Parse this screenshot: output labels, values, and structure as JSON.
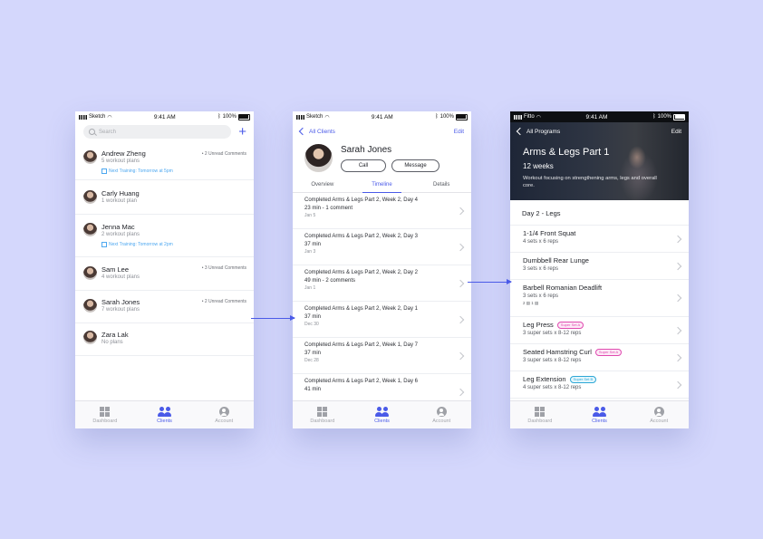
{
  "colors": {
    "accent": "#4a5ae8",
    "background": "#d4d7fc",
    "link_blue": "#4ea8f0",
    "superset_pink": "#e04ab0",
    "superset_blue": "#2da7d6"
  },
  "status_bar": {
    "carrier": "Sketch",
    "carrier3": "Fitto",
    "time": "9:41 AM",
    "battery": "100%"
  },
  "tabbar": {
    "dashboard": "Dashboard",
    "clients": "Clients",
    "account": "Account"
  },
  "screen1": {
    "search_placeholder": "Search",
    "clients": [
      {
        "name": "Andrew Zheng",
        "plans": "5 workout plans",
        "unread": "• 2 Unread Comments",
        "next": "Next Training: Tomorrow at 5pm"
      },
      {
        "name": "Carly Huang",
        "plans": "1 workout plan",
        "unread": "",
        "next": ""
      },
      {
        "name": "Jenna Mac",
        "plans": "2 workout plans",
        "unread": "",
        "next": "Next Training: Tomorrow at 2pm"
      },
      {
        "name": "Sam Lee",
        "plans": "4 workout plans",
        "unread": "• 3 Unread Comments",
        "next": ""
      },
      {
        "name": "Sarah Jones",
        "plans": "7 workout plans",
        "unread": "• 2 Unread Comments",
        "next": ""
      },
      {
        "name": "Zara Lak",
        "plans": "No plans",
        "unread": "",
        "next": ""
      }
    ]
  },
  "screen2": {
    "back": "All Clients",
    "edit": "Edit",
    "name": "Sarah Jones",
    "call": "Call",
    "message": "Message",
    "segments": [
      "Overview",
      "Timeline",
      "Details"
    ],
    "timeline": [
      {
        "title": "Completed Arms & Legs Part 2, Week 2, Day 4",
        "meta": "23 min - 1 comment",
        "date": "Jan 5"
      },
      {
        "title": "Completed Arms & Legs Part 2, Week 2, Day 3",
        "meta": "37 min",
        "date": "Jan 3"
      },
      {
        "title": "Completed Arms & Legs Part 2, Week 2, Day 2",
        "meta": "49 min - 2 comments",
        "date": "Jan 1"
      },
      {
        "title": "Completed Arms & Legs Part 2, Week 2, Day 1",
        "meta": "37 min",
        "date": "Dec 30"
      },
      {
        "title": "Completed Arms & Legs Part 2, Week 1, Day 7",
        "meta": "37 min",
        "date": "Dec 28"
      },
      {
        "title": "Completed Arms & Legs Part 2, Week 1, Day 6",
        "meta": "41 min",
        "date": ""
      }
    ]
  },
  "screen3": {
    "back": "All Programs",
    "edit": "Edit",
    "program_title": "Arms & Legs Part 1",
    "weeks": "12 weeks",
    "description": "Workout focusing on strengthening arms, legs and overall core.",
    "day": "Day 2 - Legs",
    "exercises": [
      {
        "name": "1-1/4 Front Squat",
        "sets": "4 sets x 6 reps",
        "badge": "",
        "extra": ""
      },
      {
        "name": "Dumbbell Rear Lunge",
        "sets": "3 sets x 6 reps",
        "badge": "",
        "extra": ""
      },
      {
        "name": "Barbell Romanian Deadlift",
        "sets": "3 sets x 6 reps",
        "badge": "",
        "extra": "2 ▤ 1 ▤"
      },
      {
        "name": "Leg Press",
        "sets": "3 super sets x 8-12 reps",
        "badge": "Super Set A",
        "extra": ""
      },
      {
        "name": "Seated Hamstring Curl",
        "sets": "3 super sets x 8-12 reps",
        "badge": "Super Set A",
        "extra": ""
      },
      {
        "name": "Leg Extension",
        "sets": "4 super sets x 8-12 reps",
        "badge": "Super Set B",
        "extra": ""
      }
    ]
  }
}
